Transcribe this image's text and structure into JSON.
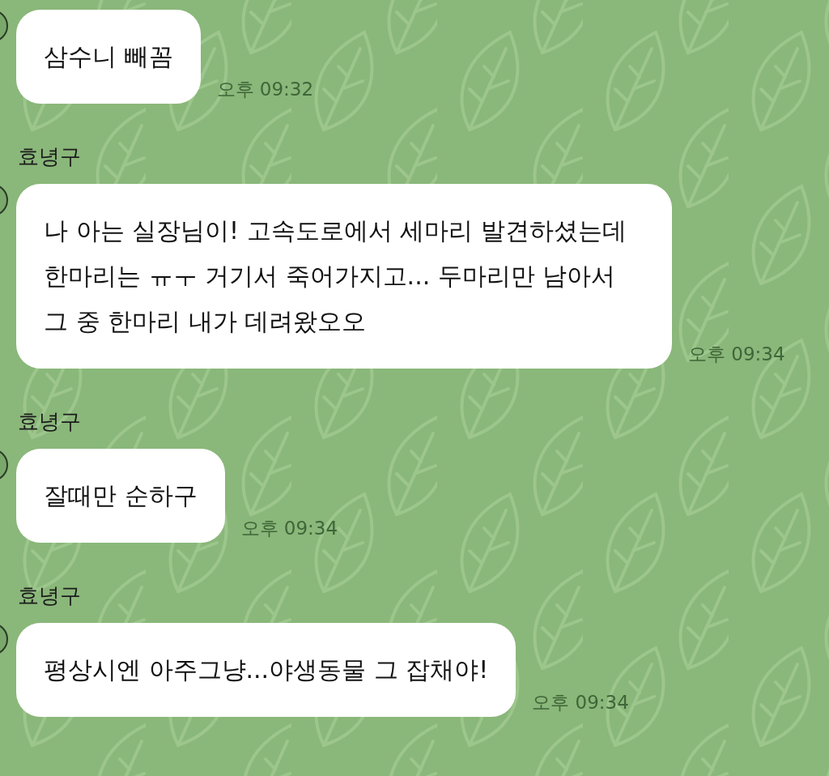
{
  "messages": [
    {
      "text": "삼수니 빼꼼",
      "time": "오후 09:32"
    },
    {
      "sender": "효녕구",
      "text": "나 아는 실장님이! 고속도로에서 세마리 발견하셨는데 한마리는 ㅠㅜ 거기서 죽어가지고... 두마리만 남아서 그 중 한마리 내가 데려왔오오",
      "time": "오후 09:34"
    },
    {
      "sender": "효녕구",
      "text": "잘때만 순하구",
      "time": "오후 09:34"
    },
    {
      "sender": "효녕구",
      "text": "평상시엔 아주그냥...야생동물 그 잡채야!",
      "time": "오후 09:34"
    }
  ]
}
